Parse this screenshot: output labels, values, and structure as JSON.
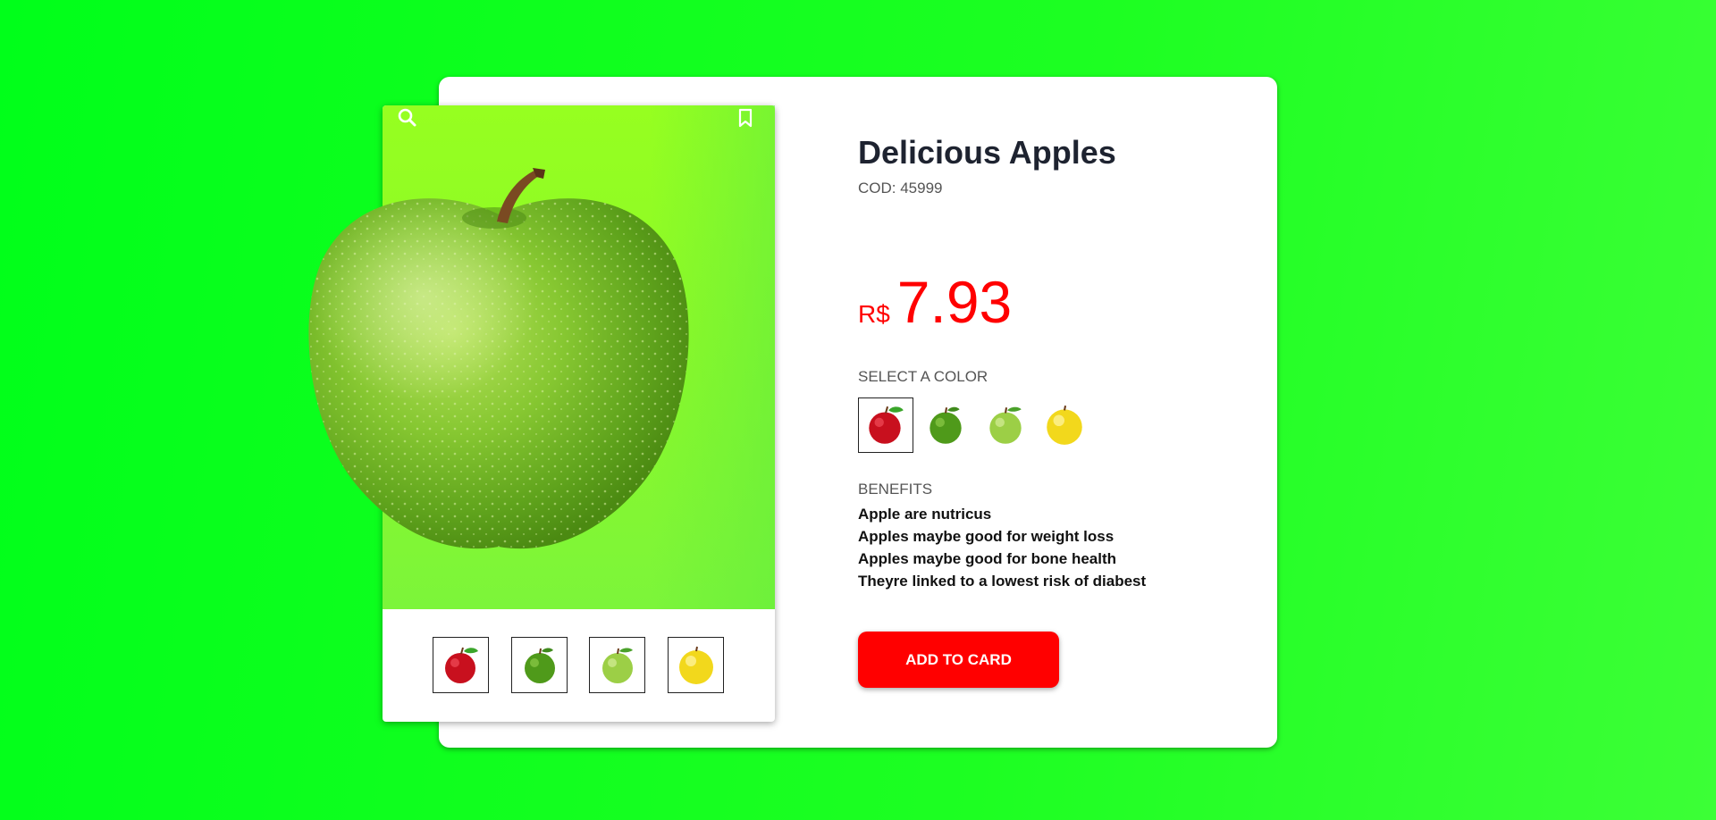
{
  "product": {
    "title": "Delicious Apples",
    "code": "COD: 45999",
    "currency": "R$",
    "price": "7.93"
  },
  "colors": {
    "label": "SELECT A COLOR",
    "options": [
      "red-apple",
      "dark-green-apple",
      "light-green-apple",
      "yellow-apple"
    ],
    "selected_index": 0
  },
  "gallery": {
    "thumbnails": [
      "red-apple",
      "dark-green-apple",
      "light-green-apple",
      "yellow-apple"
    ],
    "icons": [
      "search-icon",
      "bookmark-icon"
    ]
  },
  "benefits": {
    "label": "BENEFITS",
    "items": [
      "Apple are nutricus",
      "Apples maybe good for weight loss",
      "Apples maybe good for bone health",
      "Theyre linked to a lowest risk of diabest"
    ]
  },
  "actions": {
    "add_label": "ADD TO CARD"
  },
  "theme": {
    "background": "#1dff22",
    "accent": "#ff0000",
    "gallery_bg": "#8df928"
  }
}
